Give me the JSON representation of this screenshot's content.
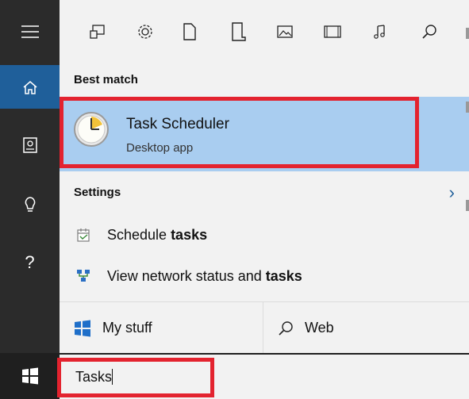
{
  "sections": {
    "best_match": "Best match",
    "settings": "Settings"
  },
  "best_match_item": {
    "title": "Task Scheduler",
    "subtitle": "Desktop app"
  },
  "settings_items": [
    {
      "prefix": "Schedule ",
      "bold": "tasks",
      "icon": "schedule-tasks-icon"
    },
    {
      "prefix": "View network status and ",
      "bold": "tasks",
      "icon": "network-status-icon"
    }
  ],
  "bottom": {
    "my_stuff": "My stuff",
    "web": "Web"
  },
  "search": {
    "query": "Tasks"
  },
  "colors": {
    "accent": "#1f5f9a",
    "selection": "#a9cdf0",
    "highlight": "#e3232f"
  }
}
